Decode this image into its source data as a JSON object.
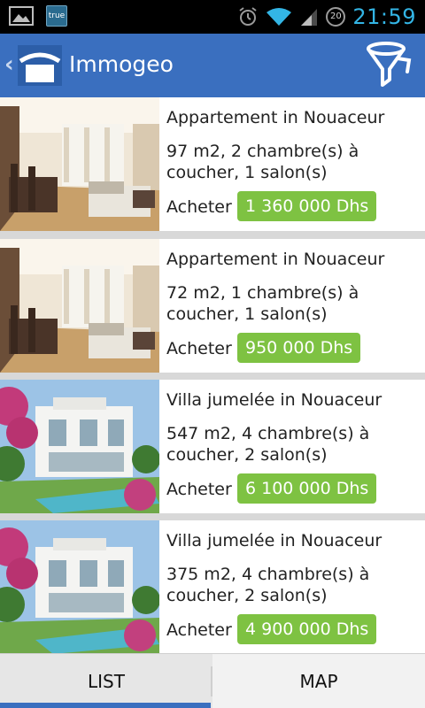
{
  "status_bar": {
    "notification_badge": "true",
    "battery_level": "20",
    "time": "21:59"
  },
  "app_bar": {
    "title": "Immogeo"
  },
  "listings": [
    {
      "title": "Appartement in Nouaceur",
      "description": "97 m2, 2 chambre(s) à coucher, 1 salon(s)",
      "action": "Acheter",
      "price": "1 360 000 Dhs",
      "photo": "living-room"
    },
    {
      "title": "Appartement in Nouaceur",
      "description": "72 m2, 1 chambre(s) à coucher, 1 salon(s)",
      "action": "Acheter",
      "price": "950 000 Dhs",
      "photo": "living-room"
    },
    {
      "title": "Villa jumelée in Nouaceur",
      "description": "547 m2, 4 chambre(s) à coucher, 2 salon(s)",
      "action": "Acheter",
      "price": "6 100 000 Dhs",
      "photo": "villa-pool"
    },
    {
      "title": "Villa jumelée in Nouaceur",
      "description": "375 m2, 4 chambre(s) à coucher, 2 salon(s)",
      "action": "Acheter",
      "price": "4 900 000 Dhs",
      "photo": "villa-pool"
    }
  ],
  "tabs": {
    "list_label": "LIST",
    "map_label": "MAP",
    "active": "LIST"
  },
  "colors": {
    "action_bar": "#3a6fbf",
    "price_badge": "#7ec242",
    "clock": "#33b5e5"
  }
}
